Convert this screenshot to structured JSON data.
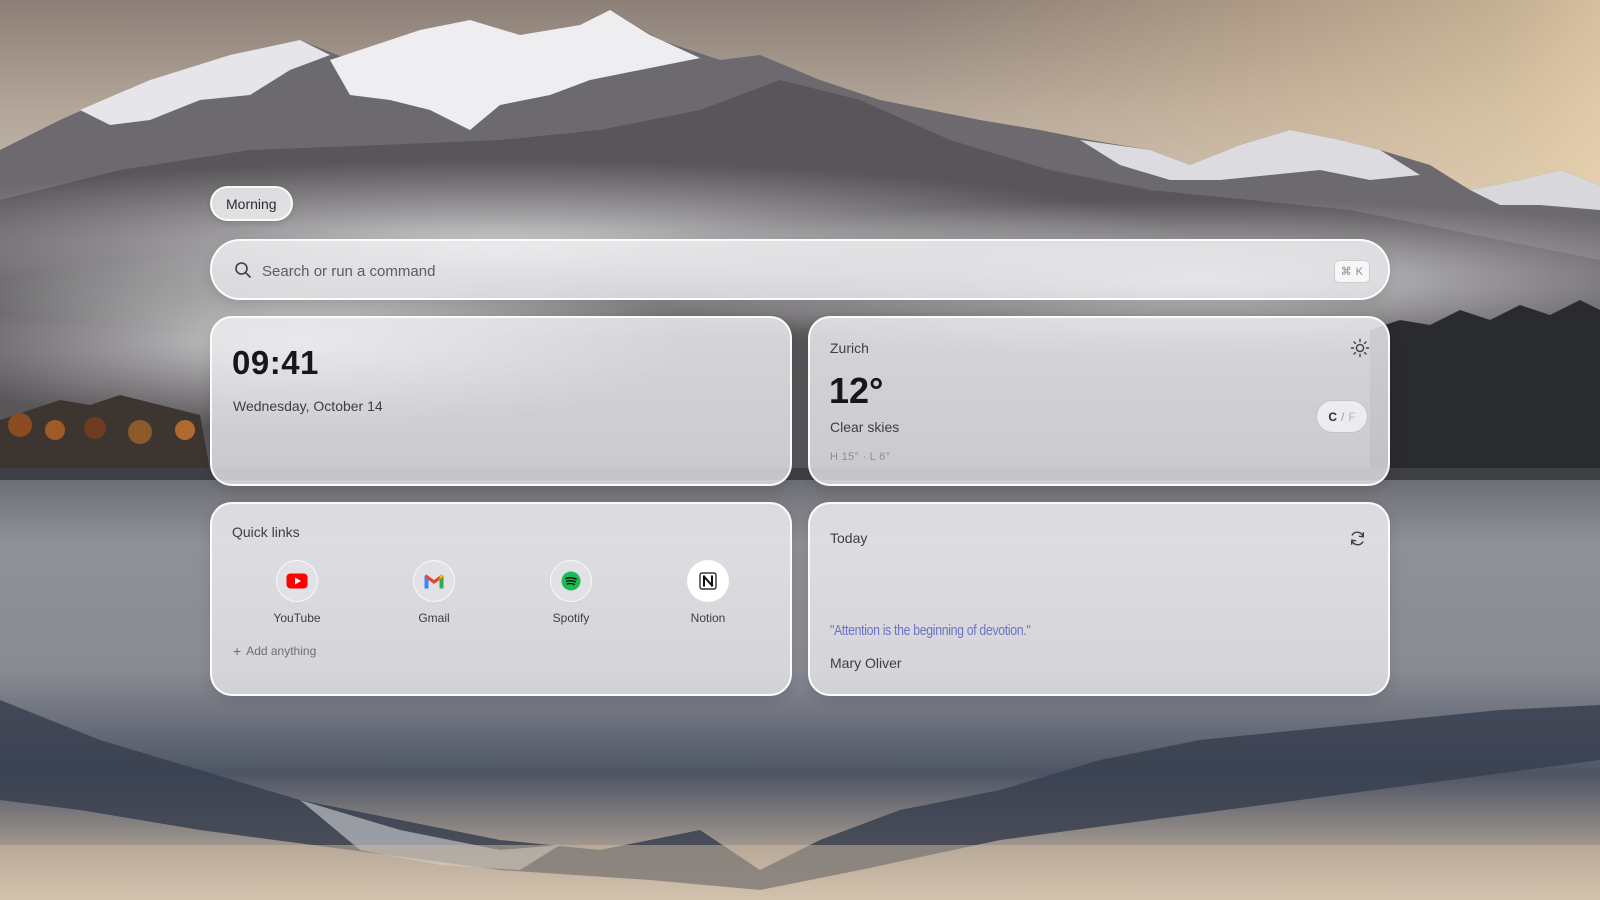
{
  "greeting": "Morning",
  "search": {
    "placeholder": "Search or run a command",
    "shortcut_symbol": "⌘",
    "shortcut_key": "K"
  },
  "clock": {
    "time": "09:41",
    "date": "Wednesday, October 14"
  },
  "weather": {
    "city": "Zurich",
    "temperature": "12°",
    "condition": "Clear skies",
    "high_low": "H 15° · L 6°",
    "unit_c": "C",
    "unit_separator": "/",
    "unit_f": "F",
    "icon": "sun-icon"
  },
  "quick_links": {
    "title": "Quick links",
    "items": [
      {
        "label": "YouTube",
        "icon": "youtube-icon",
        "color": "#ff0000"
      },
      {
        "label": "Gmail",
        "icon": "gmail-icon",
        "color": "#ea4335"
      },
      {
        "label": "Spotify",
        "icon": "spotify-icon",
        "color": "#1db954"
      },
      {
        "label": "Notion",
        "icon": "notion-icon",
        "color": "#000000"
      }
    ],
    "add_label": "Add anything"
  },
  "quote_card": {
    "title": "Today",
    "quote": "\"Attention is the beginning of devotion.\"",
    "author": "Mary Oliver",
    "quote_color": "#6c73c2"
  }
}
